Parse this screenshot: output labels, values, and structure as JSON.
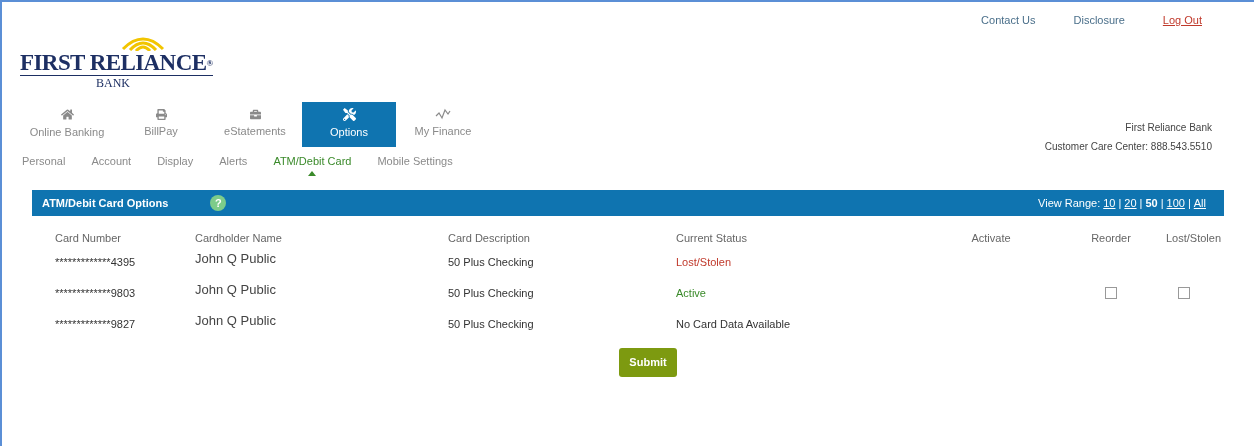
{
  "top_links": [
    {
      "label": "Contact Us",
      "kind": "plain"
    },
    {
      "label": "Disclosure",
      "kind": "plain"
    },
    {
      "label": "Log Out",
      "kind": "logout"
    }
  ],
  "logo": {
    "name": "FIRST RELIANCE",
    "mark": "®",
    "sub": "BANK"
  },
  "nav_tabs": [
    {
      "label": "Online Banking",
      "selected": false
    },
    {
      "label": "BillPay",
      "selected": false
    },
    {
      "label": "eStatements",
      "selected": false
    },
    {
      "label": "Options",
      "selected": true
    },
    {
      "label": "My Finance",
      "selected": false
    }
  ],
  "sub_tabs": [
    {
      "label": "Personal",
      "selected": false
    },
    {
      "label": "Account",
      "selected": false
    },
    {
      "label": "Display",
      "selected": false
    },
    {
      "label": "Alerts",
      "selected": false
    },
    {
      "label": "ATM/Debit Card",
      "selected": true
    },
    {
      "label": "Mobile Settings",
      "selected": false
    }
  ],
  "contact": {
    "bank": "First Reliance Bank",
    "phone": "Customer Care Center: 888.543.5510"
  },
  "panel": {
    "title": "ATM/Debit Card Options",
    "help": "?",
    "view_range_label": "View Range:",
    "separator": "|",
    "view_range": [
      {
        "label": "10",
        "selected": false
      },
      {
        "label": "20",
        "selected": false
      },
      {
        "label": "50",
        "selected": true
      },
      {
        "label": "100",
        "selected": false
      },
      {
        "label": "All",
        "selected": false
      }
    ]
  },
  "table": {
    "columns": [
      "Card Number",
      "Cardholder Name",
      "Card Description",
      "Current Status",
      "Activate",
      "Reorder",
      "Lost/Stolen"
    ],
    "rows": [
      {
        "card_number": "*************4395",
        "cardholder": "John Q Public",
        "description": "50 Plus Checking",
        "status": "Lost/Stolen",
        "kind": "lost"
      },
      {
        "card_number": "*************9803",
        "cardholder": "John Q Public",
        "description": "50 Plus Checking",
        "status": "Active",
        "kind": "active",
        "reorder": {
          "checked": false
        },
        "lost_stolen": {
          "checked": false
        }
      },
      {
        "card_number": "*************9827",
        "cardholder": "John Q Public",
        "description": "50 Plus Checking",
        "status": "No Card Data Available",
        "kind": "none"
      }
    ]
  },
  "submit": "Submit"
}
